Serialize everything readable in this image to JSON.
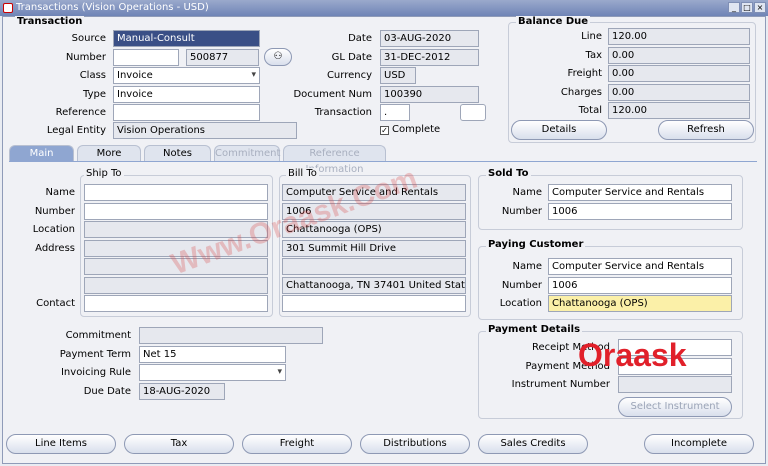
{
  "window": {
    "title": "Transactions (Vision Operations - USD)"
  },
  "transaction": {
    "section_title": "Transaction",
    "source_label": "Source",
    "source": "Manual-Consult",
    "number_label": "Number",
    "number_value": "",
    "number_secondary": "500877",
    "class_label": "Class",
    "class": "Invoice",
    "type_label": "Type",
    "type": "Invoice",
    "reference_label": "Reference",
    "reference": "",
    "legal_entity_label": "Legal Entity",
    "legal_entity": "Vision Operations",
    "date_label": "Date",
    "date": "03-AUG-2020",
    "gl_date_label": "GL Date",
    "gl_date": "31-DEC-2012",
    "currency_label": "Currency",
    "currency": "USD",
    "doc_num_label": "Document Num",
    "doc_num": "100390",
    "transaction_label": "Transaction",
    "transaction_value": ".",
    "complete_label": "Complete",
    "complete_checked": true
  },
  "balance_due": {
    "title": "Balance Due",
    "line_label": "Line",
    "line": "120.00",
    "tax_label": "Tax",
    "tax": "0.00",
    "freight_label": "Freight",
    "freight": "0.00",
    "charges_label": "Charges",
    "charges": "0.00",
    "total_label": "Total",
    "total": "120.00",
    "details_button": "Details",
    "refresh_button": "Refresh"
  },
  "tabs": [
    {
      "label": "Main",
      "active": true
    },
    {
      "label": "More"
    },
    {
      "label": "Notes"
    },
    {
      "label": "Commitment",
      "disabled": true
    },
    {
      "label": "Reference Information",
      "disabled": true
    }
  ],
  "address_labels": {
    "name": "Name",
    "number": "Number",
    "location": "Location",
    "address": "Address",
    "contact": "Contact"
  },
  "ship_to": {
    "title": "Ship To"
  },
  "bill_to": {
    "title": "Bill To",
    "name": "Computer Service and Rentals",
    "number": "1006",
    "location": "Chattanooga (OPS)",
    "address1": "301 Summit Hill Drive",
    "address4": "Chattanooga, TN 37401 United States"
  },
  "sold_to": {
    "title": "Sold To",
    "name_label": "Name",
    "name": "Computer Service and Rentals",
    "number_label": "Number",
    "number": "1006"
  },
  "paying_customer": {
    "title": "Paying Customer",
    "name_label": "Name",
    "name": "Computer Service and Rentals",
    "number_label": "Number",
    "number": "1006",
    "location_label": "Location",
    "location": "Chattanooga (OPS)"
  },
  "terms": {
    "commitment_label": "Commitment",
    "commitment": "",
    "payment_term_label": "Payment Term",
    "payment_term": "Net 15",
    "invoicing_rule_label": "Invoicing Rule",
    "invoicing_rule": "",
    "due_date_label": "Due Date",
    "due_date": "18-AUG-2020"
  },
  "payment_details": {
    "title": "Payment Details",
    "receipt_method_label": "Receipt Method",
    "payment_method_label": "Payment Method",
    "instrument_number_label": "Instrument Number",
    "select_instrument_button": "Select Instrument"
  },
  "bottom_buttons": [
    "Line Items",
    "Tax",
    "Freight",
    "Distributions",
    "Sales Credits",
    "Incomplete"
  ],
  "watermark": "Www.Oraask.Com",
  "logo": "Oraask",
  "colors": {
    "title_bar": "#7f92c0",
    "active_tab": "#8fa6d1",
    "highlight_field": "#fbf0a8",
    "logo_red": "#e1202a"
  }
}
